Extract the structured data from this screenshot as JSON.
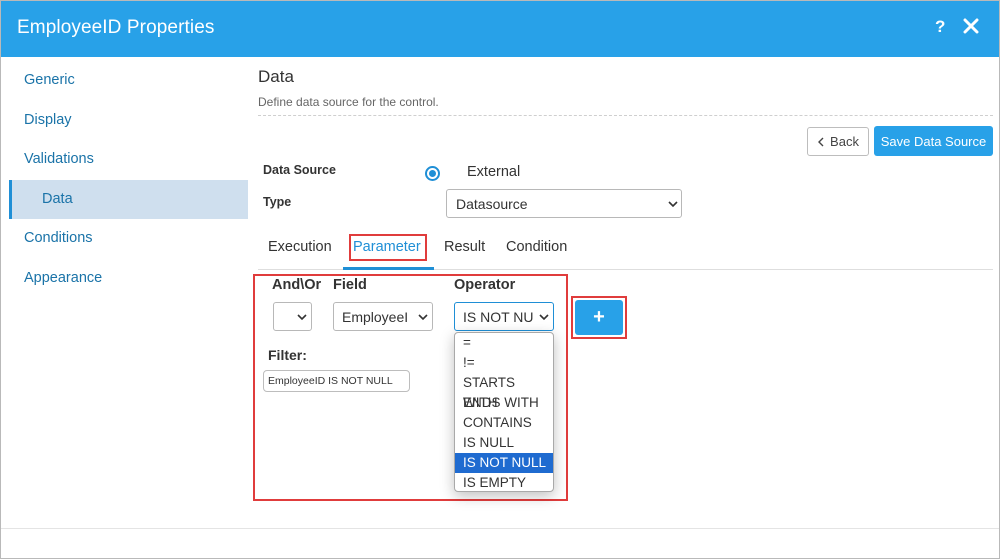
{
  "dialog": {
    "title": "EmployeeID Properties",
    "help_label": "?",
    "close_icon": "close-icon",
    "accent_color": "#28a1e8"
  },
  "sidebar": {
    "items": [
      {
        "label": "Generic"
      },
      {
        "label": "Display"
      },
      {
        "label": "Validations"
      },
      {
        "label": "Data"
      },
      {
        "label": "Conditions"
      },
      {
        "label": "Appearance"
      }
    ],
    "active": "Data"
  },
  "section": {
    "title": "Data",
    "subtitle": "Define data source for the control."
  },
  "actions": {
    "back_label": "Back",
    "save_label": "Save Data Source"
  },
  "form": {
    "data_source_label": "Data Source",
    "data_source_value": "External",
    "type_label": "Type",
    "type_value": "Datasource"
  },
  "tabs": {
    "items": [
      "Execution",
      "Parameter",
      "Result",
      "Condition"
    ],
    "active": "Parameter"
  },
  "parameter": {
    "andor_label": "And\\Or",
    "andor_value": "",
    "field_label": "Field",
    "field_value": "EmployeeI",
    "operator_label": "Operator",
    "operator_value": "IS NOT NU",
    "add_icon": "plus-icon",
    "filter_label": "Filter:",
    "filter_value": "EmployeeID IS NOT NULL",
    "operator_options": [
      "=",
      "!=",
      "STARTS WITH",
      "ENDS WITH",
      "CONTAINS",
      "IS NULL",
      "IS NOT NULL",
      "IS EMPTY"
    ],
    "selected_option": "IS NOT NULL"
  }
}
